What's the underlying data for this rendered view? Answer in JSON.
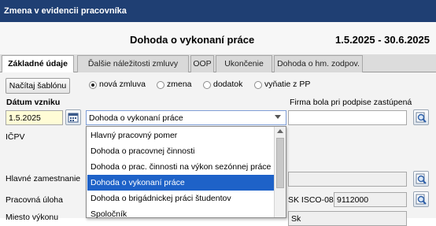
{
  "window": {
    "title": "Zmena v evidencii pracovníka"
  },
  "header": {
    "document_type": "Dohoda o vykonaní práce",
    "date_range": "1.5.2025 - 30.6.2025"
  },
  "tabs": [
    {
      "label": "Základné údaje",
      "active": true
    },
    {
      "label": "Ďalšie náležitosti zmluvy",
      "active": false
    },
    {
      "label": "OOP",
      "active": false
    },
    {
      "label": "Ukončenie",
      "active": false
    },
    {
      "label": "Dohoda o hm. zodpov.",
      "active": false
    }
  ],
  "toolbar": {
    "load_template": "Načítaj šablónu"
  },
  "radio_options": [
    {
      "label": "nová zmluva",
      "checked": true
    },
    {
      "label": "zmena",
      "checked": false
    },
    {
      "label": "dodatok",
      "checked": false
    },
    {
      "label": "vyňatie z PP",
      "checked": false
    }
  ],
  "form": {
    "start_date_label": "Dátum vzniku",
    "start_date_value": "1.5.2025",
    "contract_type_value": "Dohoda o vykonaní práce",
    "company_represented_label": "Firma bola pri podpise zastúpená",
    "icpv_label": "IČPV",
    "main_employment_label": "Hlavné zamestnanie",
    "work_task_label": "Pracovná úloha",
    "sk_isco_label": "SK ISCO-08",
    "sk_isco_value": "9112000",
    "partial_bottom_label": "Miesto výkonu",
    "partial_bottom_value": "Sk"
  },
  "dropdown": {
    "options": [
      "Hlavný pracovný pomer",
      "Dohoda o pracovnej činnosti",
      "Dohoda o prac. činnosti na výkon sezónnej práce",
      "Dohoda o vykonaní práce",
      "Dohoda o brigádnickej práci študentov",
      "Spoločník"
    ],
    "selected_index": 3
  },
  "colors": {
    "titlebar": "#1f3f73",
    "selection": "#1e62c8",
    "date_field": "#fffcd6"
  }
}
